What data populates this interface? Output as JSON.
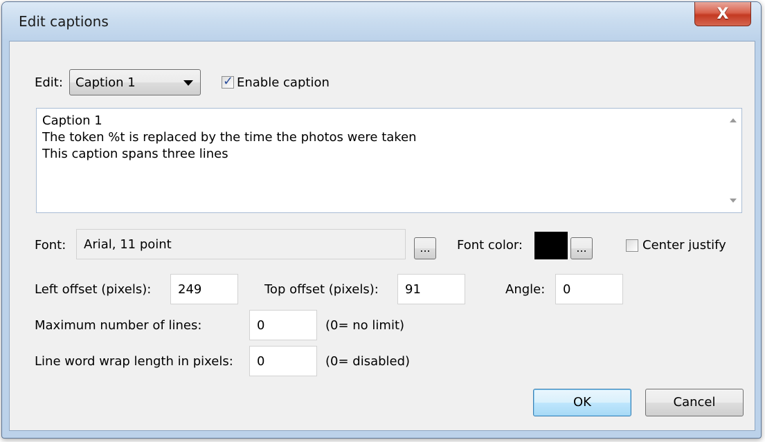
{
  "window": {
    "title": "Edit captions",
    "close_glyph": "X"
  },
  "edit": {
    "label": "Edit:",
    "selected": "Caption 1",
    "enable_caption": {
      "label": "Enable caption",
      "checked": true
    }
  },
  "caption_text": {
    "lines": [
      "Caption 1",
      "The token %t is replaced by the time the photos were taken",
      "This caption spans three lines"
    ]
  },
  "font": {
    "label": "Font:",
    "value": "Arial, 11 point",
    "browse_label": "...",
    "color_label": "Font color:",
    "color_value": "#000000",
    "color_browse_label": "...",
    "center_justify": {
      "label": "Center justify",
      "checked": false
    }
  },
  "offsets": {
    "left_label": "Left offset (pixels):",
    "left_value": "249",
    "top_label": "Top offset (pixels):",
    "top_value": "91",
    "angle_label": "Angle:",
    "angle_value": "0"
  },
  "max_lines": {
    "label": "Maximum number of lines:",
    "value": "0",
    "hint": "(0= no limit)"
  },
  "word_wrap": {
    "label": "Line word wrap length in pixels:",
    "value": "0",
    "hint": "(0= disabled)"
  },
  "buttons": {
    "ok": "OK",
    "cancel": "Cancel"
  }
}
